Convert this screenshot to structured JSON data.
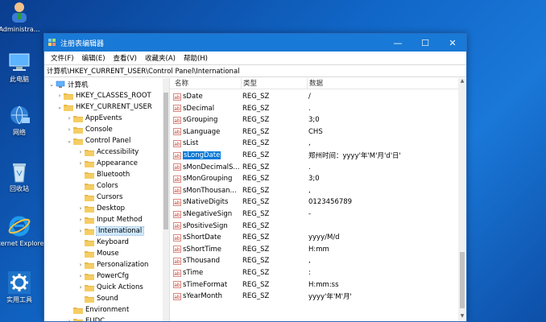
{
  "desktop": {
    "icons": [
      {
        "label": "Administra...",
        "icon": "user-icon"
      },
      {
        "label": "此电脑",
        "icon": "computer-icon"
      },
      {
        "label": "网络",
        "icon": "network-icon"
      },
      {
        "label": "回收站",
        "icon": "recycle-bin-icon"
      },
      {
        "label": "Internet Explorer",
        "icon": "internet-explorer-icon"
      },
      {
        "label": "实用工具",
        "icon": "gear-icon"
      }
    ]
  },
  "window": {
    "title": "注册表编辑器",
    "controls": {
      "minimize": "—",
      "maximize": "☐",
      "close": "✕"
    },
    "menu": [
      "文件(F)",
      "编辑(E)",
      "查看(V)",
      "收藏夹(A)",
      "帮助(H)"
    ],
    "address": "计算机\\HKEY_CURRENT_USER\\Control Panel\\International"
  },
  "tree": {
    "items": [
      {
        "label": "计算机",
        "exp": "⌄",
        "level": 0,
        "type": "computer"
      },
      {
        "label": "HKEY_CLASSES_ROOT",
        "exp": "›",
        "level": 1
      },
      {
        "label": "HKEY_CURRENT_USER",
        "exp": "⌄",
        "level": 1
      },
      {
        "label": "AppEvents",
        "exp": "›",
        "level": 2
      },
      {
        "label": "Console",
        "exp": "›",
        "level": 2
      },
      {
        "label": "Control Panel",
        "exp": "⌄",
        "level": 2
      },
      {
        "label": "Accessibility",
        "exp": "›",
        "level": 3
      },
      {
        "label": "Appearance",
        "exp": "›",
        "level": 3
      },
      {
        "label": "Bluetooth",
        "exp": "",
        "level": 3
      },
      {
        "label": "Colors",
        "exp": "",
        "level": 3
      },
      {
        "label": "Cursors",
        "exp": "",
        "level": 3
      },
      {
        "label": "Desktop",
        "exp": "›",
        "level": 3
      },
      {
        "label": "Input Method",
        "exp": "›",
        "level": 3
      },
      {
        "label": "International",
        "exp": "›",
        "level": 3,
        "selected": true
      },
      {
        "label": "Keyboard",
        "exp": "",
        "level": 3
      },
      {
        "label": "Mouse",
        "exp": "",
        "level": 3
      },
      {
        "label": "Personalization",
        "exp": "›",
        "level": 3
      },
      {
        "label": "PowerCfg",
        "exp": "›",
        "level": 3
      },
      {
        "label": "Quick Actions",
        "exp": "›",
        "level": 3
      },
      {
        "label": "Sound",
        "exp": "",
        "level": 3
      },
      {
        "label": "Environment",
        "exp": "",
        "level": 2
      },
      {
        "label": "EUDC",
        "exp": "›",
        "level": 2
      }
    ]
  },
  "list": {
    "headers": {
      "name": "名称",
      "type": "类型",
      "data": "数据"
    },
    "rows": [
      {
        "name": "sDate",
        "type": "REG_SZ",
        "data": "/"
      },
      {
        "name": "sDecimal",
        "type": "REG_SZ",
        "data": "."
      },
      {
        "name": "sGrouping",
        "type": "REG_SZ",
        "data": "3;0"
      },
      {
        "name": "sLanguage",
        "type": "REG_SZ",
        "data": "CHS"
      },
      {
        "name": "sList",
        "type": "REG_SZ",
        "data": ","
      },
      {
        "name": "sLongDate",
        "type": "REG_SZ",
        "data": "郑州时间：yyyy'年'M'月'd'日'",
        "selected": true
      },
      {
        "name": "sMonDecimalS...",
        "type": "REG_SZ",
        "data": "."
      },
      {
        "name": "sMonGrouping",
        "type": "REG_SZ",
        "data": "3;0"
      },
      {
        "name": "sMonThousan...",
        "type": "REG_SZ",
        "data": ","
      },
      {
        "name": "sNativeDigits",
        "type": "REG_SZ",
        "data": "0123456789"
      },
      {
        "name": "sNegativeSign",
        "type": "REG_SZ",
        "data": "-"
      },
      {
        "name": "sPositiveSign",
        "type": "REG_SZ",
        "data": ""
      },
      {
        "name": "sShortDate",
        "type": "REG_SZ",
        "data": "yyyy/M/d"
      },
      {
        "name": "sShortTime",
        "type": "REG_SZ",
        "data": "H:mm"
      },
      {
        "name": "sThousand",
        "type": "REG_SZ",
        "data": ","
      },
      {
        "name": "sTime",
        "type": "REG_SZ",
        "data": ":"
      },
      {
        "name": "sTimeFormat",
        "type": "REG_SZ",
        "data": "H:mm:ss"
      },
      {
        "name": "sYearMonth",
        "type": "REG_SZ",
        "data": "yyyy'年'M'月'"
      }
    ]
  },
  "colors": {
    "titlebar": "#1979d6",
    "selection": "#0078d7",
    "tree_selection": "#cce8ff",
    "folder": "#e8b94a"
  }
}
